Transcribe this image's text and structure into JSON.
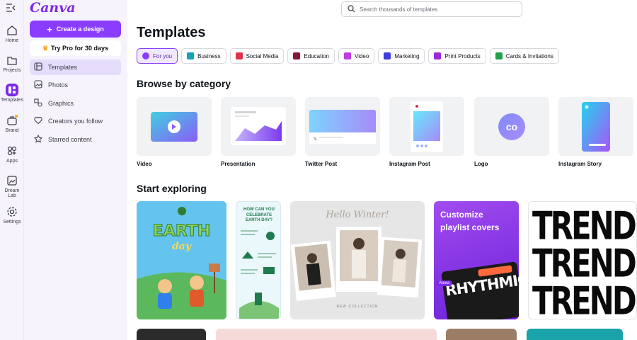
{
  "rail": {
    "items": [
      {
        "label": "Home",
        "icon": "home-icon"
      },
      {
        "label": "Projects",
        "icon": "folder-icon"
      },
      {
        "label": "Templates",
        "icon": "templates-icon"
      },
      {
        "label": "Brand",
        "icon": "brand-icon"
      },
      {
        "label": "Apps",
        "icon": "apps-icon"
      },
      {
        "label": "Dream Lab",
        "icon": "dream-lab-icon"
      },
      {
        "label": "Settings",
        "icon": "gear-icon"
      }
    ]
  },
  "sidebar": {
    "logo": "Canva",
    "create_label": "Create a design",
    "pro_label": "Try Pro for 30 days",
    "items": [
      {
        "label": "Templates"
      },
      {
        "label": "Photos"
      },
      {
        "label": "Graphics"
      },
      {
        "label": "Creators you follow"
      },
      {
        "label": "Starred content"
      }
    ]
  },
  "search": {
    "placeholder": "Search thousands of templates"
  },
  "main": {
    "title": "Templates",
    "chips": [
      {
        "label": "For you",
        "color": "#8b3dff"
      },
      {
        "label": "Business",
        "color": "#13a3b5"
      },
      {
        "label": "Social Media",
        "color": "#e0314b"
      },
      {
        "label": "Education",
        "color": "#8a1538"
      },
      {
        "label": "Video",
        "color": "#c13ce0"
      },
      {
        "label": "Marketing",
        "color": "#3d3de0"
      },
      {
        "label": "Print Products",
        "color": "#9b2ad8"
      },
      {
        "label": "Cards & Invitations",
        "color": "#1fa34a"
      }
    ],
    "browse_heading": "Browse by category",
    "categories": [
      {
        "label": "Video"
      },
      {
        "label": "Presentation"
      },
      {
        "label": "Twitter Post"
      },
      {
        "label": "Instagram Post"
      },
      {
        "label": "Logo"
      },
      {
        "label": "Instagram Story"
      }
    ],
    "explore_heading": "Start exploring",
    "tiles": {
      "earth_title": "EARTH",
      "earth_sub": "day",
      "infographic_title": "HOW CAN YOU CELEBRATE EARTH DAY?",
      "winter_title": "Hello Winter!",
      "winter_sub": "NEW COLLECTION",
      "playlist_title": "Customize playlist covers",
      "playlist_art": "RHYTHMIC",
      "playlist_tag": "Alexa",
      "trends_word": "TRENDS"
    }
  },
  "colors": {
    "accent": "#8b3dff",
    "rail_bg": "#f6f3fd"
  }
}
